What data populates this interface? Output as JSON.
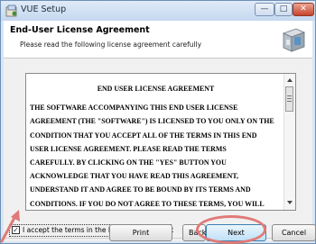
{
  "window": {
    "title": "VUE Setup",
    "minimize_glyph": "—",
    "maximize_glyph": "□",
    "close_glyph": "✕"
  },
  "header": {
    "title": "End-User License Agreement",
    "subtitle": "Please read the following license agreement carefully"
  },
  "license": {
    "heading": "END USER LICENSE AGREEMENT",
    "lines": [
      "THE SOFTWARE ACCOMPANYING THIS END USER LICENSE",
      "AGREEMENT (THE \"SOFTWARE\") IS LICENSED TO YOU ONLY ON THE",
      "CONDITION THAT YOU ACCEPT ALL OF THE TERMS IN THIS END",
      "USER LICENSE AGREEMENT.  PLEASE READ THE TERMS",
      "CAREFULLY.  BY CLICKING ON THE \"YES\" BUTTON YOU",
      "ACKNOWLEDGE THAT YOU HAVE READ THIS AGREEMENT,",
      "UNDERSTAND IT AND AGREE TO BE BOUND BY ITS TERMS AND",
      "CONDITIONS.  IF YOU DO NOT AGREE TO THESE TERMS, YOU WILL"
    ]
  },
  "accept": {
    "label": "I accept the terms in the License Agreement",
    "checked": true,
    "check_glyph": "✓"
  },
  "buttons": {
    "print": "Print",
    "back": "Back",
    "next": "Next",
    "cancel": "Cancel"
  },
  "annotation": {
    "highlight_color": "#e07a78"
  },
  "icons": {
    "app": "setup-app-icon",
    "header": "install-box-icon",
    "pointer": "pointer-arrow-icon"
  }
}
